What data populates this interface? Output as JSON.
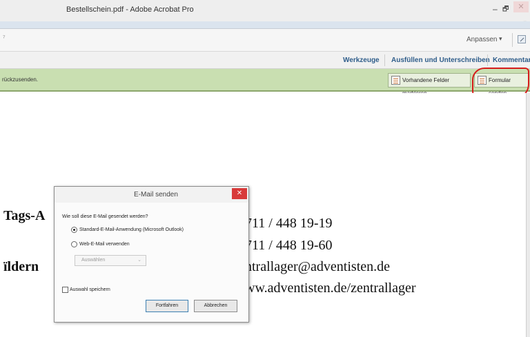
{
  "window": {
    "title": "Bestellschein.pdf - Adobe Acrobat Pro",
    "min_glyph": "–",
    "max_glyph": "🗗",
    "close_glyph": "✕",
    "chevron": "»"
  },
  "toolbar": {
    "left_mark": "⁷",
    "customize_label": "Anpassen",
    "customize_caret": "▾"
  },
  "task_panes": {
    "tools": "Werkzeuge",
    "fill_sign": "Ausfüllen und Unterschreiben",
    "comment": "Kommentar"
  },
  "form_bar": {
    "message": "rückzusenden.",
    "highlight_fields_label": "Vorhandene Felder markieren",
    "submit_form_label": "Formular senden",
    "annotation_color": "#d71b1b"
  },
  "document": {
    "line1_left": "Tags-A",
    "line1_right": "711 / 448 19-19",
    "line2_right": "711 / 448 19-60",
    "line3_left": "ïldern",
    "line3_right": "ntrallager@adventisten.de",
    "line4_right": "ww.adventisten.de/zentrallager"
  },
  "dialog": {
    "title": "E-Mail senden",
    "close_glyph": "✕",
    "question": "Wie soll diese E-Mail gesendet werden?",
    "option_default": "Standard-E-Mail-Anwendung (Microsoft Outlook)",
    "option_webmail": "Web-E-Mail verwenden",
    "select_placeholder": "Auswählen",
    "select_caret": "⌄",
    "save_choice_label": "Auswahl speichern",
    "continue_label": "Fortfahren",
    "cancel_label": "Abbrechen",
    "selected_option": "Standard-E-Mail-Anwendung (Microsoft Outlook)",
    "save_choice_checked": false
  },
  "colors": {
    "form_bar_bg": "#c9dfb1",
    "pane_tab_text": "#2f5d8a",
    "dialog_close_bg": "#d83a3a"
  }
}
